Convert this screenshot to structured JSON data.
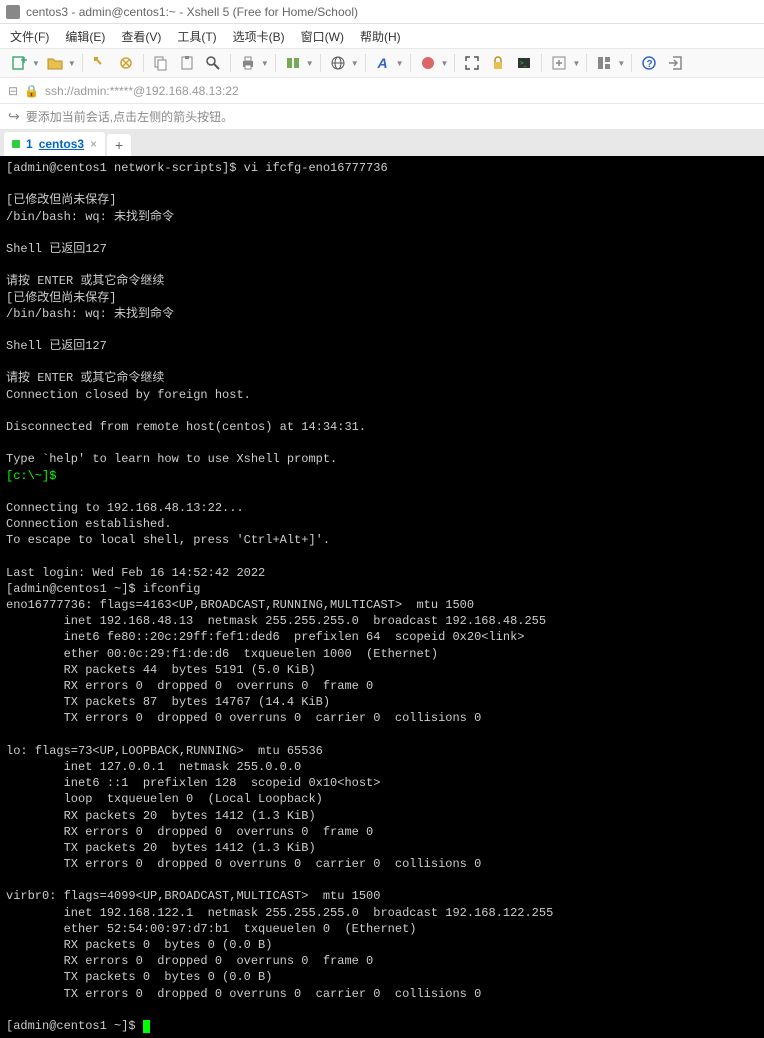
{
  "window": {
    "title": "centos3 - admin@centos1:~ - Xshell 5 (Free for Home/School)"
  },
  "menu": {
    "file": "文件(F)",
    "edit": "编辑(E)",
    "view": "查看(V)",
    "tools": "工具(T)",
    "tabs": "选项卡(B)",
    "window": "窗口(W)",
    "help": "帮助(H)"
  },
  "address": {
    "url": "ssh://admin:*****@192.168.48.13:22"
  },
  "hint": {
    "text": "要添加当前会话,点击左侧的箭头按钮。"
  },
  "tab": {
    "num": "1",
    "name": "centos3"
  },
  "term": {
    "l01": "[admin@centos1 network-scripts]$ vi ifcfg-eno16777736",
    "l02": "",
    "l03": "[已修改但尚未保存]",
    "l04": "/bin/bash: wq: 未找到命令",
    "l05": "",
    "l06": "Shell 已返回127",
    "l07": "",
    "l08": "请按 ENTER 或其它命令继续",
    "l09": "[已修改但尚未保存]",
    "l10": "/bin/bash: wq: 未找到命令",
    "l11": "",
    "l12": "Shell 已返回127",
    "l13": "",
    "l14": "请按 ENTER 或其它命令继续",
    "l15": "Connection closed by foreign host.",
    "l16": "",
    "l17": "Disconnected from remote host(centos) at 14:34:31.",
    "l18": "",
    "l19": "Type `help' to learn how to use Xshell prompt.",
    "l20": "[c:\\~]$",
    "l21": "",
    "l22": "Connecting to 192.168.48.13:22...",
    "l23": "Connection established.",
    "l24": "To escape to local shell, press 'Ctrl+Alt+]'.",
    "l25": "",
    "l26": "Last login: Wed Feb 16 14:52:42 2022",
    "l27": "[admin@centos1 ~]$ ifconfig",
    "l28": "eno16777736: flags=4163<UP,BROADCAST,RUNNING,MULTICAST>  mtu 1500",
    "l29": "        inet 192.168.48.13  netmask 255.255.255.0  broadcast 192.168.48.255",
    "l30": "        inet6 fe80::20c:29ff:fef1:ded6  prefixlen 64  scopeid 0x20<link>",
    "l31": "        ether 00:0c:29:f1:de:d6  txqueuelen 1000  (Ethernet)",
    "l32": "        RX packets 44  bytes 5191 (5.0 KiB)",
    "l33": "        RX errors 0  dropped 0  overruns 0  frame 0",
    "l34": "        TX packets 87  bytes 14767 (14.4 KiB)",
    "l35": "        TX errors 0  dropped 0 overruns 0  carrier 0  collisions 0",
    "l36": "",
    "l37": "lo: flags=73<UP,LOOPBACK,RUNNING>  mtu 65536",
    "l38": "        inet 127.0.0.1  netmask 255.0.0.0",
    "l39": "        inet6 ::1  prefixlen 128  scopeid 0x10<host>",
    "l40": "        loop  txqueuelen 0  (Local Loopback)",
    "l41": "        RX packets 20  bytes 1412 (1.3 KiB)",
    "l42": "        RX errors 0  dropped 0  overruns 0  frame 0",
    "l43": "        TX packets 20  bytes 1412 (1.3 KiB)",
    "l44": "        TX errors 0  dropped 0 overruns 0  carrier 0  collisions 0",
    "l45": "",
    "l46": "virbr0: flags=4099<UP,BROADCAST,MULTICAST>  mtu 1500",
    "l47": "        inet 192.168.122.1  netmask 255.255.255.0  broadcast 192.168.122.255",
    "l48": "        ether 52:54:00:97:d7:b1  txqueuelen 0  (Ethernet)",
    "l49": "        RX packets 0  bytes 0 (0.0 B)",
    "l50": "        RX errors 0  dropped 0  overruns 0  frame 0",
    "l51": "        TX packets 0  bytes 0 (0.0 B)",
    "l52": "        TX errors 0  dropped 0 overruns 0  carrier 0  collisions 0",
    "l53": "",
    "l54": "[admin@centos1 ~]$ "
  }
}
